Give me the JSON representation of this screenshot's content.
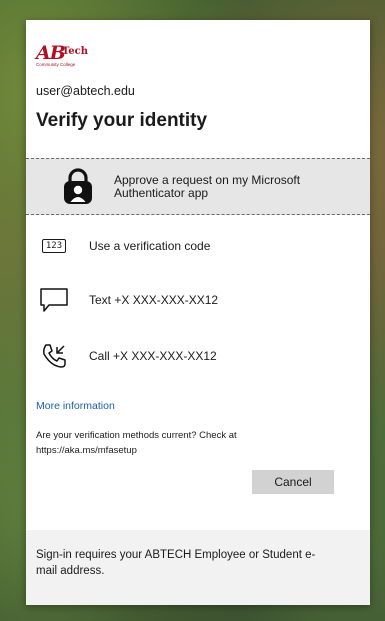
{
  "logo": {
    "brand": "ABTech",
    "subtitle": "Community College"
  },
  "user_email": "user@abtech.edu",
  "title": "Verify your identity",
  "options": [
    {
      "label": "Approve a request on my Microsoft Authenticator app",
      "icon": "authenticator-lock-icon"
    },
    {
      "label": "Use a verification code",
      "icon": "verification-code-icon",
      "icon_text": "123"
    },
    {
      "label": "Text +X XXX-XXX-XX12",
      "icon": "message-icon"
    },
    {
      "label": "Call +X XXX-XXX-XX12",
      "icon": "phone-icon"
    }
  ],
  "more_info": "More information",
  "note_line1": "Are your verification methods current? Check at",
  "note_line2": "https://aka.ms/mfasetup",
  "cancel_label": "Cancel",
  "footer": "Sign-in requires your ABTECH Employee or Student e-mail address.",
  "colors": {
    "brand": "#b30f24",
    "link": "#1b5ea8",
    "selected_bg": "#e6e6e6"
  }
}
